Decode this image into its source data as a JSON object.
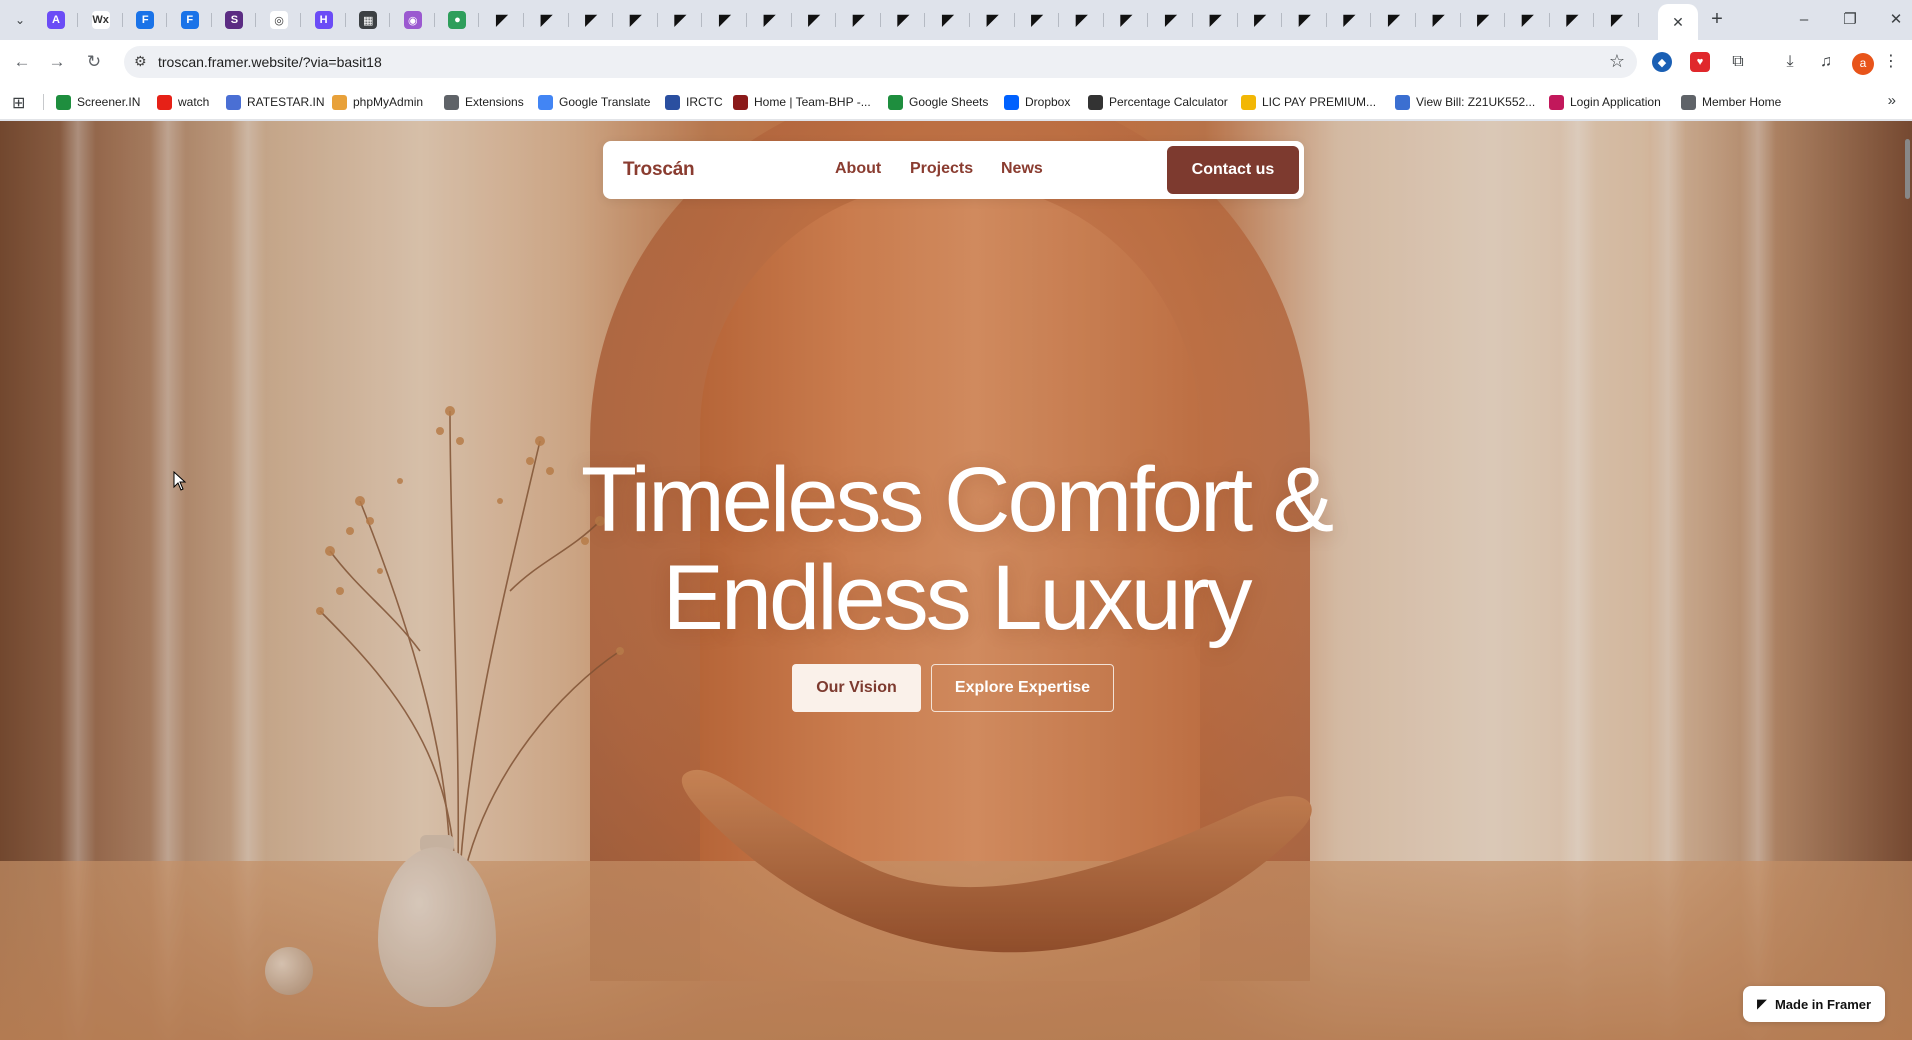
{
  "browser": {
    "pinned_tabs": [
      {
        "icon": "app-a-icon",
        "color": "#6b4cf6",
        "glyph": "A"
      },
      {
        "icon": "wix-icon",
        "color": "#ffffff",
        "glyph": "Wx"
      },
      {
        "icon": "framer-blue-icon",
        "color": "#1a73e8",
        "glyph": "F"
      },
      {
        "icon": "framer-blue-icon",
        "color": "#1a73e8",
        "glyph": "F"
      },
      {
        "icon": "site-icon",
        "color": "#5b2c83",
        "glyph": "S"
      },
      {
        "icon": "spiral-icon",
        "color": "#ffffff",
        "glyph": "◎"
      },
      {
        "icon": "purple-h-icon",
        "color": "#6b4cf6",
        "glyph": "H"
      },
      {
        "icon": "layout-icon",
        "color": "#3c4043",
        "glyph": "▦"
      },
      {
        "icon": "lilac-icon",
        "color": "#9b59d0",
        "glyph": "◉"
      },
      {
        "icon": "leaf-icon",
        "color": "#2e9e5b",
        "glyph": "●"
      },
      {
        "icon": "framer-icon"
      },
      {
        "icon": "framer-icon"
      },
      {
        "icon": "framer-icon"
      },
      {
        "icon": "framer-icon"
      },
      {
        "icon": "framer-icon"
      },
      {
        "icon": "framer-icon"
      },
      {
        "icon": "framer-icon"
      },
      {
        "icon": "framer-icon"
      },
      {
        "icon": "framer-icon"
      },
      {
        "icon": "framer-icon"
      },
      {
        "icon": "framer-icon"
      },
      {
        "icon": "framer-icon"
      },
      {
        "icon": "framer-icon"
      },
      {
        "icon": "framer-icon"
      },
      {
        "icon": "framer-icon"
      },
      {
        "icon": "framer-icon"
      },
      {
        "icon": "framer-icon"
      },
      {
        "icon": "framer-icon"
      },
      {
        "icon": "framer-icon"
      },
      {
        "icon": "framer-icon"
      },
      {
        "icon": "framer-icon"
      },
      {
        "icon": "framer-icon"
      },
      {
        "icon": "framer-icon"
      },
      {
        "icon": "framer-icon"
      },
      {
        "icon": "framer-icon"
      },
      {
        "icon": "framer-icon"
      }
    ],
    "active_tab_close": "✕",
    "new_tab": "+",
    "url": "troscan.framer.website/?via=basit18",
    "avatar_letter": "a",
    "bookmarks": [
      {
        "label": "Screener.IN",
        "icon": "screener-icon",
        "color": "#1e8e3e"
      },
      {
        "label": "watch",
        "icon": "youtube-icon",
        "color": "#e62117"
      },
      {
        "label": "RATESTAR.IN",
        "icon": "ratestar-icon",
        "color": "#4a6fd4"
      },
      {
        "label": "phpMyAdmin",
        "icon": "phpmyadmin-icon",
        "color": "#e8a13a"
      },
      {
        "label": "Extensions",
        "icon": "puzzle-icon",
        "color": "#5f6368"
      },
      {
        "label": "Google Translate",
        "icon": "translate-icon",
        "color": "#4285f4"
      },
      {
        "label": "IRCTC",
        "icon": "irctc-icon",
        "color": "#2a4fa0"
      },
      {
        "label": "Home | Team-BHP -...",
        "icon": "teambhp-icon",
        "color": "#8b1a1a"
      },
      {
        "label": "Google Sheets",
        "icon": "sheets-icon",
        "color": "#1e8e3e"
      },
      {
        "label": "Dropbox",
        "icon": "dropbox-icon",
        "color": "#0061fe"
      },
      {
        "label": "Percentage Calculator",
        "icon": "calculator-icon",
        "color": "#333333"
      },
      {
        "label": "LIC PAY PREMIUM...",
        "icon": "lic-icon",
        "color": "#f2b705"
      },
      {
        "label": "View Bill: Z21UK552...",
        "icon": "bill-icon",
        "color": "#3b6fd1"
      },
      {
        "label": "Login Application",
        "icon": "login-icon",
        "color": "#c2185b"
      },
      {
        "label": "Member Home",
        "icon": "globe-icon",
        "color": "#5f6368"
      }
    ]
  },
  "site": {
    "brand": "Troscán",
    "nav": [
      "About",
      "Projects",
      "News"
    ],
    "contact": "Contact us",
    "hero_line1": "Timeless Comfort &",
    "hero_line2": "Endless Luxury",
    "btn_primary": "Our Vision",
    "btn_secondary": "Explore Expertise",
    "badge": "Made in Framer",
    "colors": {
      "accent": "#7d3a2f",
      "brand_text": "#8a3c30",
      "button_light": "#faf1ea"
    }
  }
}
